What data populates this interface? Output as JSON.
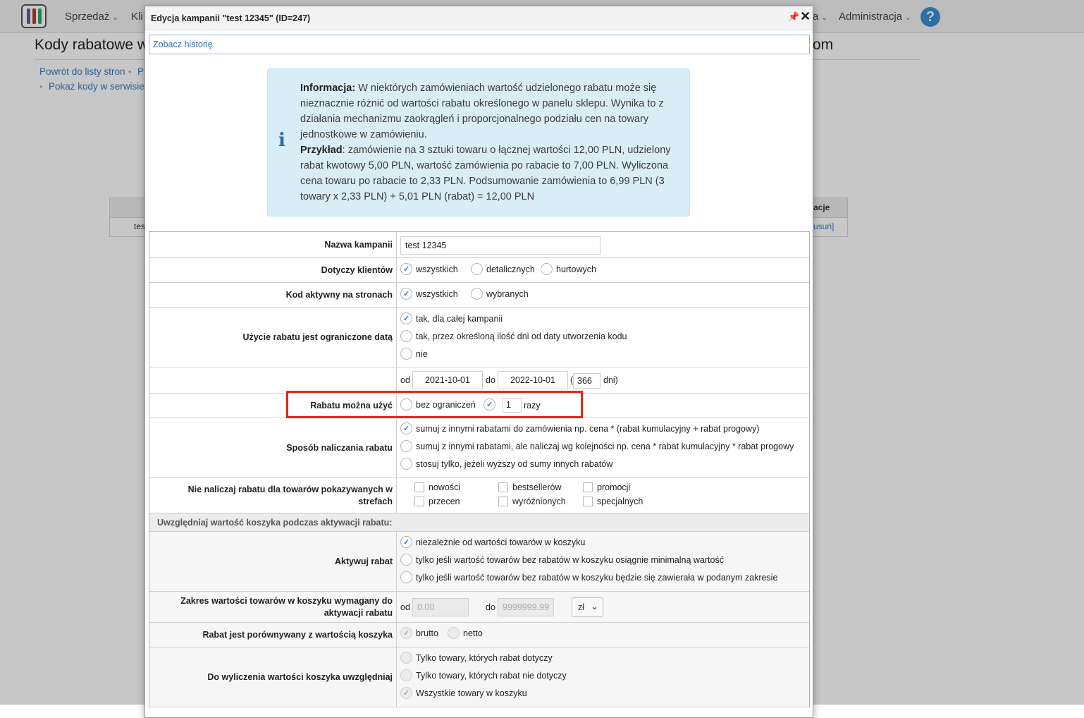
{
  "topnav": {
    "items": [
      {
        "label": "Sprzedaż",
        "chevron": true
      },
      {
        "label": "Kli",
        "chevron": false
      },
      {
        "label": "a",
        "chevron": true
      },
      {
        "label": "Administracja",
        "chevron": true
      }
    ],
    "help_icon": "?"
  },
  "page": {
    "title": "Kody rabatowe w",
    "title_tail": "om",
    "links": [
      "Powrót do listy stron",
      "P",
      "Pokaż kody w serwisie"
    ],
    "table_header_tail": "acje",
    "table_cell_head": "tes",
    "table_cell_action": "usuń]"
  },
  "modal": {
    "title": "Edycja kampanii \"test 12345\" (ID=247)",
    "history_link": "Zobacz historię",
    "info": {
      "info_label": "Informacja:",
      "info_text": " W niektórych zamówieniach wartość udzielonego rabatu może się nieznacznie różnić od wartości rabatu określonego w panelu sklepu. Wynika to z działania mechanizmu zaokrągleń i proporcjonalnego podziału cen na towary jednostkowe w zamówieniu.",
      "example_label": "Przykład",
      "example_text": ": zamówienie na 3 sztuki towaru o łącznej wartości 12,00 PLN, udzielony rabat kwotowy 5,00 PLN, wartość zamówienia po rabacie to 7,00 PLN. Wyliczona cena towaru po rabacie to 2,33 PLN. Podsumowanie zamówienia to 6,99 PLN (3 towary x 2,33 PLN) + 5,01 PLN (rabat) = 12,00 PLN"
    },
    "form": {
      "campaign_name": {
        "label": "Nazwa kampanii",
        "value": "test 12345"
      },
      "clients": {
        "label": "Dotyczy klientów",
        "options": [
          "wszystkich",
          "detalicznych",
          "hurtowych"
        ],
        "selected": "wszystkich"
      },
      "active_pages": {
        "label": "Kod aktywny na stronach",
        "options": [
          "wszystkich",
          "wybranych"
        ],
        "selected": "wszystkich"
      },
      "date_limit": {
        "label": "Użycie rabatu jest ograniczone datą",
        "options": [
          "tak, dla całej kampanii",
          "tak, przez określoną ilość dni od daty utworzenia kodu",
          "nie"
        ],
        "selected": "tak, dla całej kampanii"
      },
      "date_range": {
        "from_label": "od",
        "from": "2021-10-01",
        "to_label": "do",
        "to": "2022-10-01",
        "paren_open": "(",
        "days": "366",
        "days_label": "dni)"
      },
      "usage": {
        "label": "Rabatu można użyć",
        "option_unlimited": "bez ograniczeń",
        "times_value": "1",
        "times_label": "razy",
        "selected": "times"
      },
      "calc_method": {
        "label": "Sposób naliczania rabatu",
        "options": [
          "sumuj z innymi rabatami do zamówienia np. cena * (rabat kumulacyjny + rabat progowy)",
          "sumuj z innymi rabatami, ale naliczaj wg kolejności np. cena * rabat kumulacyjny * rabat progowy",
          "stosuj tylko, jeżeli wyższy od sumy innych rabatów"
        ],
        "selected": 0
      },
      "exclude_zones": {
        "label": "Nie naliczaj rabatu dla towarów pokazywanych w strefach",
        "options": [
          "nowości",
          "bestsellerów",
          "promocji",
          "przecen",
          "wyróżnionych",
          "specjalnych"
        ]
      },
      "section_header": "Uwzględniaj wartość koszyka podczas aktywacji rabatu:",
      "activate": {
        "label": "Aktywuj rabat",
        "options": [
          "niezależnie od wartości towarów w koszyku",
          "tylko jeśli wartość towarów bez rabatów w koszyku osiągnie minimalną wartość",
          "tylko jeśli wartość towarów bez rabatów w koszyku będzie się zawierała w podanym zakresie"
        ],
        "selected": 0
      },
      "value_range": {
        "label": "Zakres wartości towarów w koszyku wymagany do aktywacji rabatu",
        "from_label": "od",
        "from_placeholder": "0.00",
        "to_label": "do",
        "to_placeholder": "9999999.99",
        "currency": "zł"
      },
      "compare": {
        "label": "Rabat jest porównywany z wartością koszyka",
        "options": [
          "brutto",
          "netto"
        ],
        "selected": "brutto"
      },
      "cart_value": {
        "label": "Do wyliczenia wartości koszyka uwzględniaj",
        "options": [
          "Tylko towary, których rabat dotyczy",
          "Tylko towary, których rabat nie dotyczy",
          "Wszystkie towary w koszyku"
        ],
        "selected": 2
      }
    }
  },
  "colors": {
    "highlight": "#e3261b",
    "link": "#2f6fae",
    "info_bg": "#d9edf7"
  }
}
